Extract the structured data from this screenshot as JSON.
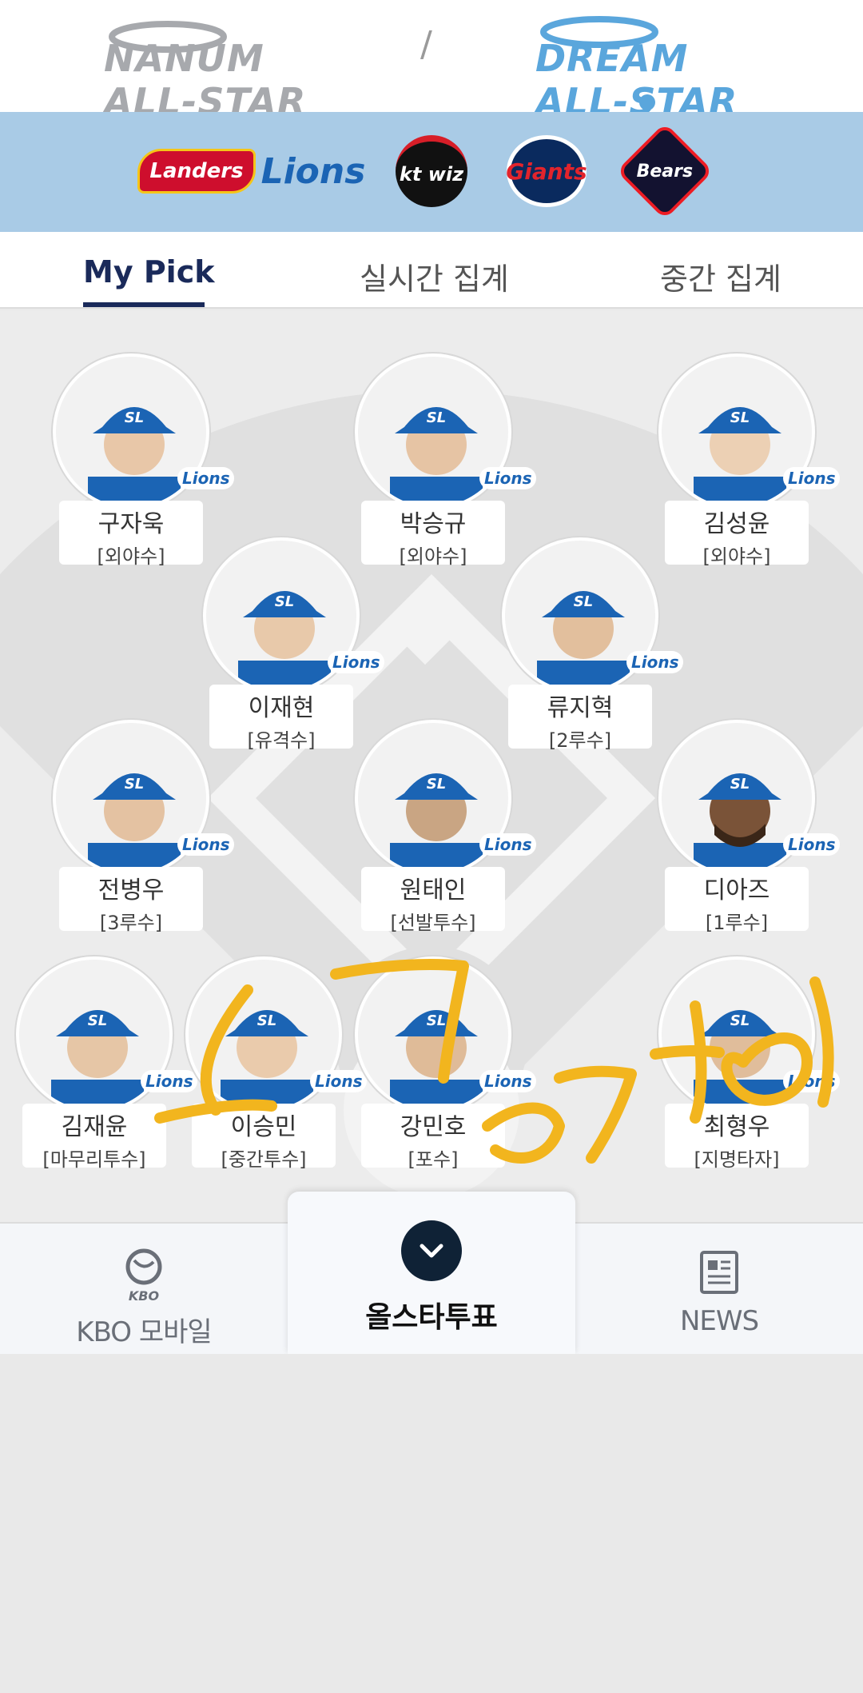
{
  "header": {
    "nanum_brand": "NANUM ALL-STAR",
    "separator": "/",
    "dream_brand": "DREAM ALL-STAR"
  },
  "teams": [
    {
      "name": "Landers",
      "icon": "ssg-landers-logo"
    },
    {
      "name": "Lions",
      "icon": "samsung-lions-logo"
    },
    {
      "name": "kt wiz",
      "icon": "kt-wiz-logo"
    },
    {
      "name": "Giants",
      "icon": "lotte-giants-logo"
    },
    {
      "name": "Bears",
      "icon": "doosan-bears-logo"
    }
  ],
  "tabs": [
    {
      "label": "My Pick",
      "active": true
    },
    {
      "label": "실시간 집계",
      "active": false
    },
    {
      "label": "중간 집계",
      "active": false
    }
  ],
  "players": [
    {
      "name": "구자욱",
      "position": "[외야수]",
      "team_badge": "Lions"
    },
    {
      "name": "박승규",
      "position": "[외야수]",
      "team_badge": "Lions"
    },
    {
      "name": "김성윤",
      "position": "[외야수]",
      "team_badge": "Lions"
    },
    {
      "name": "이재현",
      "position": "[유격수]",
      "team_badge": "Lions"
    },
    {
      "name": "류지혁",
      "position": "[2루수]",
      "team_badge": "Lions"
    },
    {
      "name": "전병우",
      "position": "[3루수]",
      "team_badge": "Lions"
    },
    {
      "name": "원태인",
      "position": "[선발투수]",
      "team_badge": "Lions"
    },
    {
      "name": "디아즈",
      "position": "[1루수]",
      "team_badge": "Lions"
    },
    {
      "name": "김재윤",
      "position": "[마무리투수]",
      "team_badge": "Lions"
    },
    {
      "name": "이승민",
      "position": "[중간투수]",
      "team_badge": "Lions"
    },
    {
      "name": "강민호",
      "position": "[포수]",
      "team_badge": "Lions"
    },
    {
      "name": "최형우",
      "position": "[지명타자]",
      "team_badge": "Lions"
    }
  ],
  "bottom_nav": {
    "kbo_label": "KBO 모바일",
    "kbo_mark": "KBO",
    "vote_label": "올스타투표",
    "news_label": "NEWS"
  },
  "colors": {
    "team_bar": "#a9cbe6",
    "active_tab": "#1a2a5a",
    "dream_blue": "#5aa6dc",
    "lions_blue": "#1b64b4",
    "scribble": "#f2b51e"
  }
}
